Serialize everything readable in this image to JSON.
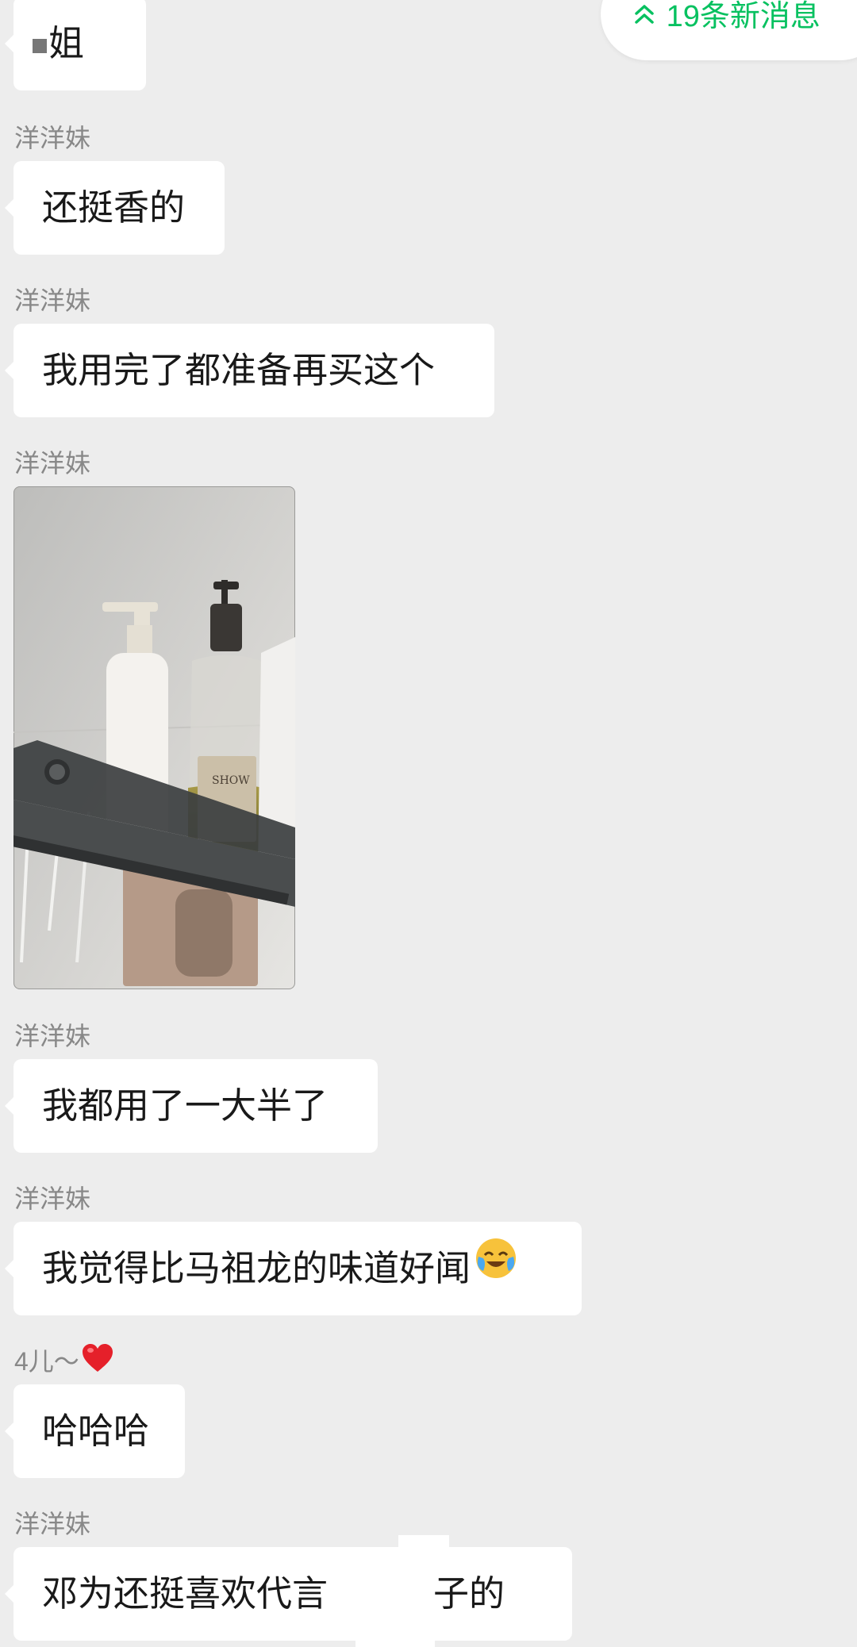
{
  "new_messages": {
    "label": "19条新消息"
  },
  "messages": [
    {
      "sender": "",
      "text": "姐"
    },
    {
      "sender": "洋洋妹",
      "text": "还挺香的"
    },
    {
      "sender": "洋洋妹",
      "text": "我用完了都准备再买这个"
    },
    {
      "sender": "洋洋妹",
      "image": "bathroom shelf photo with shampoo and shower gel bottles"
    },
    {
      "sender": "洋洋妹",
      "text": "我都用了一大半了"
    },
    {
      "sender": "洋洋妹",
      "text": "我觉得比马祖龙的味道好闻",
      "emoji": "crying-laughing-face"
    },
    {
      "sender": "4儿～",
      "sender_emoji": "red-heart",
      "text": "哈哈哈"
    },
    {
      "sender": "洋洋妹",
      "text": "邓为还挺喜欢代言",
      "text_after_redaction": "牌子的"
    }
  ],
  "colors": {
    "background": "#ededed",
    "bubble": "#ffffff",
    "accent_green": "#07c160",
    "sender_gray": "#888888"
  }
}
